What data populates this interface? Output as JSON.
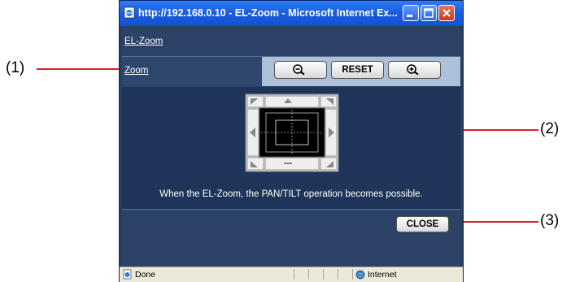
{
  "window": {
    "title": "http://192.168.0.10 - EL-Zoom - Microsoft Internet Ex..."
  },
  "page": {
    "heading_link": "EL-Zoom",
    "zoom_link": "Zoom",
    "reset_label": "RESET",
    "hint": "When the EL-Zoom, the PAN/TILT operation becomes possible.",
    "close_label": "CLOSE"
  },
  "statusbar": {
    "left_text": "Done",
    "zone_text": "Internet"
  },
  "callouts": [
    "(1)",
    "(2)",
    "(3)"
  ],
  "colors": {
    "callout_line": "#d8202a",
    "title_bar": "#1a5fe0",
    "panel_bg": "#1e3458",
    "zoom_bar": "#adc0da"
  },
  "icons": [
    "ie-page-icon",
    "minimize-icon",
    "maximize-icon",
    "close-icon",
    "zoom-out-icon",
    "zoom-in-icon",
    "pan-tilt-pad",
    "done-page-icon",
    "internet-globe-icon"
  ]
}
